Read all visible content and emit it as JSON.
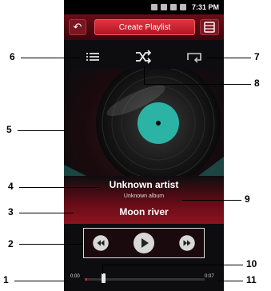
{
  "status": {
    "time": "7:31 PM"
  },
  "header": {
    "back_icon": "back-arrow-icon",
    "title": "Create Playlist",
    "menu_icon": "menu-icon"
  },
  "controls": {
    "list_icon": "list-icon",
    "shuffle_icon": "shuffle-icon",
    "repeat_icon": "repeat-icon"
  },
  "track": {
    "artist": "Unknown artist",
    "album": "Unknown album",
    "title": "Moon river"
  },
  "player": {
    "previous_icon": "previous-icon",
    "play_icon": "play-icon",
    "next_icon": "next-icon"
  },
  "progress": {
    "elapsed": "0:00",
    "total": "0:07",
    "fraction": 0.02
  },
  "callouts": [
    "1",
    "2",
    "3",
    "4",
    "5",
    "6",
    "7",
    "8",
    "9",
    "10",
    "11"
  ],
  "colors": {
    "accent": "#c8202d",
    "dark_red": "#5a0a12",
    "teal": "#2bb3a6"
  }
}
